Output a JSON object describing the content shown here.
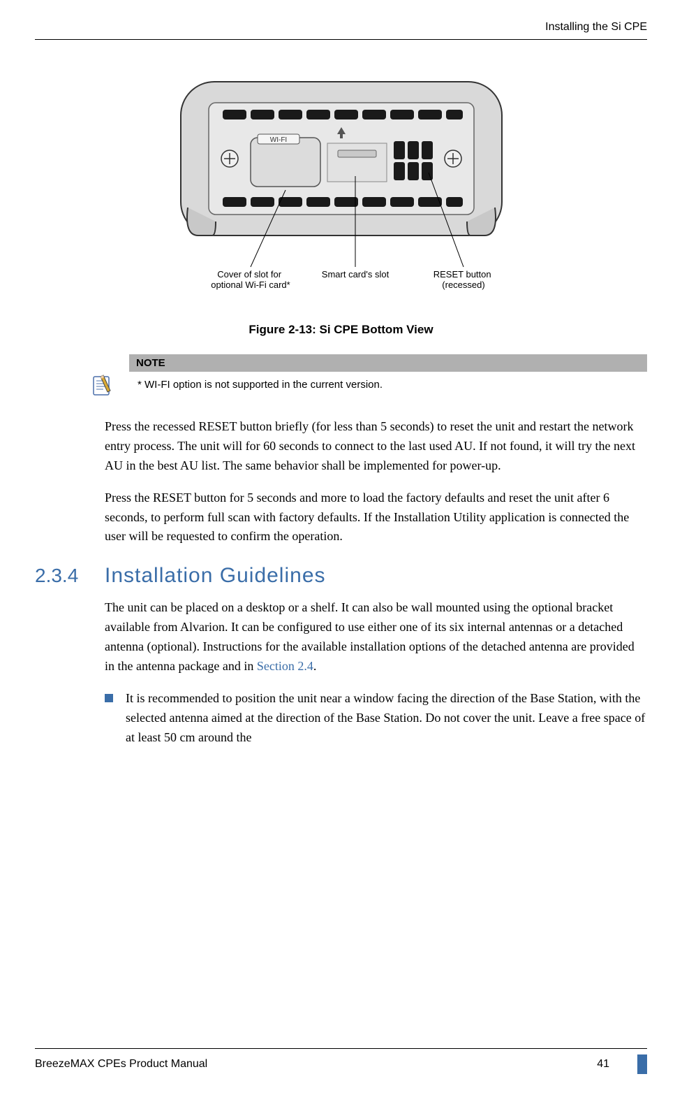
{
  "header": {
    "section_title": "Installing the Si CPE"
  },
  "figure": {
    "labels": {
      "wifi": "WI-FI",
      "cover_slot": "Cover of slot for\noptional Wi-Fi card*",
      "smart_card": "Smart card's slot",
      "reset": "RESET button\n(recessed)"
    },
    "caption": "Figure 2-13: Si CPE Bottom View"
  },
  "note": {
    "header": "NOTE",
    "text": "* WI-FI option is not supported in the current version."
  },
  "paragraphs": {
    "p1": "Press the recessed RESET button briefly (for less than 5 seconds) to reset the unit and restart the network entry process. The unit will for 60 seconds to connect to the last used AU. If not found, it will try the next AU in the best AU list. The same behavior shall be implemented for power-up.",
    "p2": "Press the RESET button for 5 seconds and more to load the factory defaults and reset the unit after 6 seconds, to perform full scan with factory defaults. If the Installation Utility application is connected the user will be requested to confirm the operation."
  },
  "section": {
    "number": "2.3.4",
    "title": "Installation Guidelines",
    "intro_a": "The unit can be placed on a desktop or a shelf. It can also be wall mounted using the optional bracket available from Alvarion. It can be configured to use either one of its six internal antennas or a detached antenna (optional). Instructions for the available installation options of the detached antenna are provided in the antenna package and in ",
    "intro_link": "Section 2.4",
    "intro_b": ".",
    "bullet1": "It is recommended to position the unit near a window facing the direction of the Base Station, with the selected antenna aimed at the direction of the Base Station. Do not cover the unit. Leave a free space of at least 50 cm around the"
  },
  "footer": {
    "manual": "BreezeMAX CPEs Product Manual",
    "page": "41"
  }
}
